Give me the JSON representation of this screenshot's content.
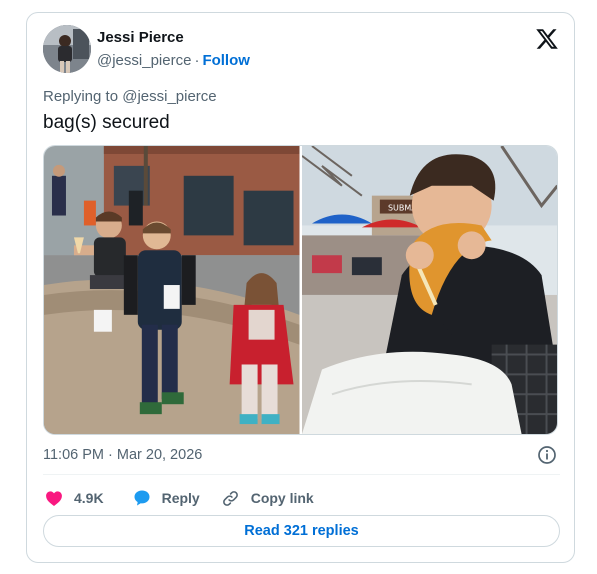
{
  "author": {
    "name": "Jessi Pierce",
    "handle": "@jessi_pierce",
    "separator": "·",
    "follow_label": "Follow"
  },
  "reply_context": "Replying to @jessi_pierce",
  "tweet_text": "bag(s) secured",
  "media": {
    "photo_2_sign": "SUBMARINE"
  },
  "timestamp": "11:06 PM · Mar 20, 2026",
  "actions": {
    "like_count": "4.9K",
    "reply_label": "Reply",
    "copy_link_label": "Copy link"
  },
  "read_replies_label": "Read 321 replies",
  "colors": {
    "like": "#f91880",
    "reply": "#1d9bf0",
    "link": "#006fd6",
    "muted": "#536471"
  }
}
